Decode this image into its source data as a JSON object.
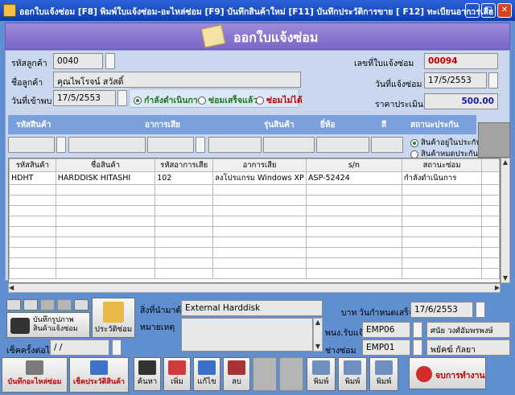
{
  "window": {
    "title": "ออกใบแจ้งซ่อม  [F8]  พิมพ์ใบแจ้งซ่อม-อะไหล่ซ่อม  [F9] บันทึกสินค้าใหม่ [F11] บันทึกประวัติการขาย [ F12] ทะเบียนอาการเสีย"
  },
  "header": {
    "title": "ออกใบแจ้งซ่อม"
  },
  "form": {
    "customer_code_label": "รหัสลูกค้า",
    "customer_code": "0040",
    "customer_name_label": "ชื่อลูกค้า",
    "customer_name": "คุณไพโรจน์ สวัสดิ์",
    "visit_date_label": "วันที่เข้าพบ",
    "visit_date": "17/5/2553",
    "ticket_no_label": "เลขที่ใบแจ้งซ่อม",
    "ticket_no": "00094",
    "notify_date_label": "วันที่แจ้งซ่อม",
    "notify_date": "17/5/2553",
    "estimate_label": "ราคาประเมิน",
    "estimate": "500.00"
  },
  "status_radios": [
    {
      "label": "กำลังดำเนินการ",
      "selected": true,
      "color": "#1a7a1a"
    },
    {
      "label": "ซ่อมเสร็จแล้ว",
      "selected": false,
      "color": "#1a7a1a"
    },
    {
      "label": "ซ่อมไม่ได้",
      "selected": false,
      "color": "#c00000"
    }
  ],
  "entry_headers": [
    "รหัสสินค้า",
    "อาการเสีย",
    "รุ่นสินค้า",
    "ยี่ห้อ",
    "สี",
    "สถานะประกัน"
  ],
  "warranty_radios": [
    {
      "label": "สินค้าอยู่ในประกัน",
      "selected": true
    },
    {
      "label": "สินค้าหมดประกัน",
      "selected": false
    }
  ],
  "grid": {
    "columns": [
      "รหัสสินค้า",
      "ชื่อสินค้า",
      "รหัสอาการเสีย",
      "อาการเสีย",
      "s/n",
      "สถานะซ่อม"
    ],
    "rows": [
      [
        "HDHT",
        "HARDDISK HITASHI",
        "102",
        "ลงโปรแกรม Windows XP",
        "ASP-52424",
        "กำลังดำเนินการ"
      ]
    ]
  },
  "bottom": {
    "photo_button": "บันทึกรูปภาพสินค้าแจ้งซ่อม",
    "history_button": "ประวัติซ่อม",
    "items_label": "สิ่งที่นำมาด้วย",
    "items_value": "External Harddisk",
    "note_label": "หมายเหตุ",
    "next_check_label": "เช็คครั้งต่อไป",
    "next_check_value": " / /",
    "baht_label": "บาท",
    "due_date_label": "วันกำหนดเสร็จ",
    "due_date": "17/6/2553",
    "receiver_label": "พนง.รับแจ้ง",
    "receiver_code": "EMP06",
    "receiver_name": "ศนัย วงศ์อัมพรพงษ์",
    "tech_label": "ช่างซ่อม",
    "tech_code": "EMP01",
    "tech_name": "พยัคฆ์ กัลยา"
  },
  "toolbar": {
    "parts_record": "บันทึกอะไหล่ซ่อม",
    "check_history": "เช็คประวัติสินค้า",
    "search": "ค้นหา",
    "add": "เพิ่ม",
    "edit": "แก้ไข",
    "delete": "ลบ",
    "print1": "พิมพ์",
    "print2": "พิมพ์",
    "print3": "พิมพ์",
    "exit": "จบการทำงาน"
  }
}
